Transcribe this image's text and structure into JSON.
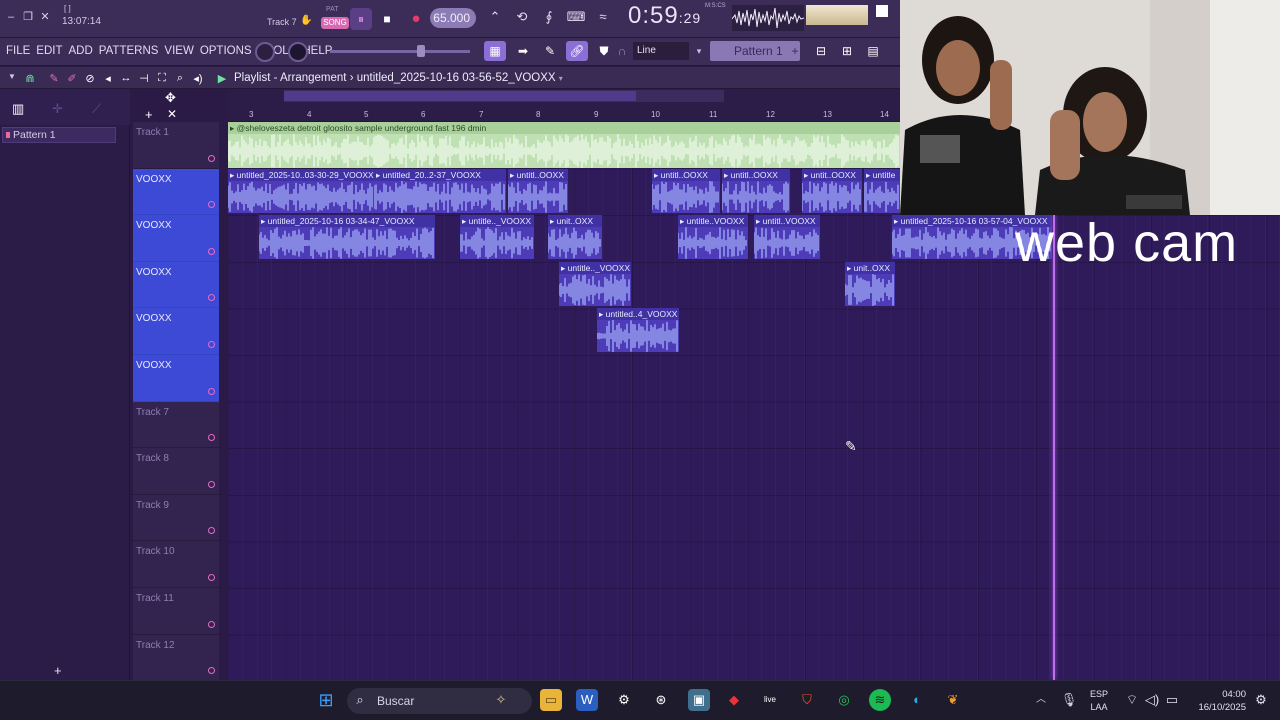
{
  "transport": {
    "bracket": "[ ]",
    "elapsed": "13:07:14",
    "track_hint": "Track 7",
    "pat_label": "PAT",
    "song_label": "SONG",
    "tempo": "65.000",
    "time_main": "0:59",
    "time_sub": ":29",
    "msc_label": "M:S:CS"
  },
  "menu": {
    "items": [
      "FILE",
      "EDIT",
      "ADD",
      "PATTERNS",
      "VIEW",
      "OPTIONS",
      "TOOLS",
      "HELP"
    ],
    "snap": "Line",
    "pattern": "Pattern 1"
  },
  "playlist": {
    "title": "Playlist - Arrangement",
    "separator": "›",
    "project": "untitled_2025-10-16 03-56-52_VOOXX",
    "ruler_numbers": [
      "3",
      "4",
      "5",
      "6",
      "7",
      "8",
      "9",
      "10",
      "11",
      "12",
      "13",
      "14"
    ]
  },
  "picker": {
    "pattern": "Pattern 1"
  },
  "tracks": [
    {
      "label": "Track 1",
      "selected": false
    },
    {
      "label": "VOOXX",
      "selected": true
    },
    {
      "label": "VOOXX",
      "selected": true
    },
    {
      "label": "VOOXX",
      "selected": true
    },
    {
      "label": "VOOXX",
      "selected": true
    },
    {
      "label": "VOOXX",
      "selected": true
    },
    {
      "label": "Track 7",
      "selected": false
    },
    {
      "label": "Track 8",
      "selected": false
    },
    {
      "label": "Track 9",
      "selected": false
    },
    {
      "label": "Track 10",
      "selected": false
    },
    {
      "label": "Track 11",
      "selected": false
    },
    {
      "label": "Track 12",
      "selected": false
    }
  ],
  "clips": {
    "track1": "@shelovesze­ta detroit gloosito sample underground fast 196 dmin",
    "t2": [
      "untitled_2025-10..03-30-29_VOOXX",
      "untitled_20..2-37_VOOXX",
      "untitl..OOXX",
      "untitl..OOXX",
      "untitl..OOXX",
      "untit..OOXX",
      "untitle"
    ],
    "t3": [
      "untitled_2025-10-16 03-34-47_VOOXX",
      "untitle.._VOOXX",
      "unit..OXX",
      "untitle..VOOXX",
      "untitl..VOOXX",
      "untitled_2025-10-16 03-57-04_VOOXX"
    ],
    "t4": [
      "untitle.._VOOXX",
      "unit..OXX"
    ],
    "t5": [
      "untitled..4_VOOXX"
    ]
  },
  "overlay": {
    "webcam_label": "web cam"
  },
  "taskbar": {
    "search": "Buscar",
    "lang_1": "ESP",
    "lang_2": "LAA",
    "time": "04:00",
    "date": "16/10/2025"
  },
  "colors": {
    "grid": "#2f1a5a",
    "selected_track": "#3d4ad6",
    "clip_blue": "#4d3bb8",
    "clip_green": "#bfe0b2",
    "accent_pink": "#e86ac8",
    "playhead": "#c06ef0"
  },
  "icons": [
    "minimize-icon",
    "maximize-icon",
    "close-icon",
    "pause-icon",
    "stop-icon",
    "record-icon",
    "metronome-icon",
    "loop-icon",
    "search-icon",
    "windows-start-icon",
    "steam-icon",
    "word-icon",
    "folder-icon",
    "spotify-icon",
    "whatsapp-icon",
    "brave-icon",
    "edge-icon",
    "fl-studio-icon",
    "wifi-icon",
    "speaker-icon",
    "battery-icon"
  ]
}
